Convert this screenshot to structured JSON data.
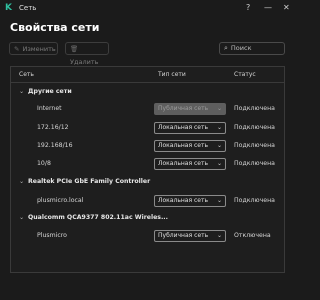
{
  "window": {
    "app_title": "Сеть",
    "help": "?",
    "minimize": "—",
    "close": "✕"
  },
  "page_title": "Свойства сети",
  "toolbar": {
    "edit_label": "Изменить",
    "delete_label": "Удалить",
    "search_placeholder": "Поиск"
  },
  "table": {
    "headers": {
      "network": "Сеть",
      "type": "Тип сети",
      "status": "Статус"
    },
    "groups": [
      {
        "name": "Другие сети",
        "rows": [
          {
            "name": "Internet",
            "type": "Публичная сеть",
            "status": "Подключена",
            "disabled": true
          },
          {
            "name": "172.16/12",
            "type": "Локальная сеть",
            "status": "Подключена"
          },
          {
            "name": "192.168/16",
            "type": "Локальная сеть",
            "status": "Подключена"
          },
          {
            "name": "10/8",
            "type": "Локальная сеть",
            "status": "Подключена"
          }
        ]
      },
      {
        "name": "Realtek PCIe GbE Family Controller",
        "rows": [
          {
            "name": "plusmicro.local",
            "type": "Локальная сеть",
            "status": "Подключена"
          }
        ]
      },
      {
        "name": "Qualcomm QCA9377 802.11ac Wireles...",
        "rows": [
          {
            "name": "Plusmicro",
            "type": "Публичная сеть",
            "status": "Отключена"
          }
        ]
      }
    ]
  },
  "icons": {
    "logo": "kaspersky-logo",
    "edit": "pencil-icon",
    "delete": "trash-icon",
    "search": "search-icon",
    "group_expand": "chevron-down-icon",
    "dropdown": "chevron-down-icon"
  },
  "colors": {
    "background": "#1b1b1b",
    "accent": "#2fbf9f"
  }
}
